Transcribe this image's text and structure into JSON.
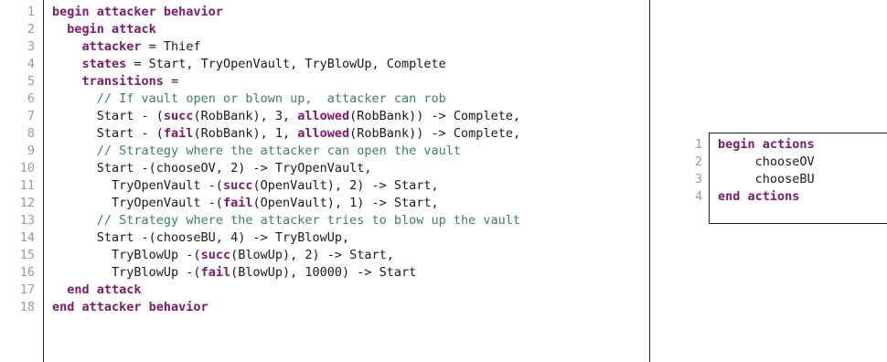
{
  "listings": [
    {
      "line_numbers": [
        "1",
        "2",
        "3",
        "4",
        "5",
        "6",
        "7",
        "8",
        "9",
        "10",
        "11",
        "12",
        "13",
        "14",
        "15",
        "16",
        "17",
        "18"
      ],
      "lines": [
        [
          {
            "t": "begin attacker behavior",
            "c": "kw"
          }
        ],
        [
          {
            "t": "  "
          },
          {
            "t": "begin attack",
            "c": "kw"
          }
        ],
        [
          {
            "t": "    "
          },
          {
            "t": "attacker",
            "c": "kw"
          },
          {
            "t": " = Thief"
          }
        ],
        [
          {
            "t": "    "
          },
          {
            "t": "states",
            "c": "kw"
          },
          {
            "t": " = Start, TryOpenVault, TryBlowUp, Complete"
          }
        ],
        [
          {
            "t": "    "
          },
          {
            "t": "transitions",
            "c": "kw"
          },
          {
            "t": " ="
          }
        ],
        [
          {
            "t": "      "
          },
          {
            "t": "// If vault open or blown up,  attacker can rob",
            "c": "cm"
          }
        ],
        [
          {
            "t": "      Start - ("
          },
          {
            "t": "succ",
            "c": "kw"
          },
          {
            "t": "(RobBank), 3, "
          },
          {
            "t": "allowed",
            "c": "kw"
          },
          {
            "t": "(RobBank)) -> Complete,"
          }
        ],
        [
          {
            "t": "      Start - ("
          },
          {
            "t": "fail",
            "c": "kw"
          },
          {
            "t": "(RobBank), 1, "
          },
          {
            "t": "allowed",
            "c": "kw"
          },
          {
            "t": "(RobBank)) -> Complete,"
          }
        ],
        [
          {
            "t": "      "
          },
          {
            "t": "// Strategy where the attacker can open the vault",
            "c": "cm"
          }
        ],
        [
          {
            "t": "      Start -(chooseOV, 2) -> TryOpenVault,"
          }
        ],
        [
          {
            "t": "        TryOpenVault -("
          },
          {
            "t": "succ",
            "c": "kw"
          },
          {
            "t": "(OpenVault), 2) -> Start,"
          }
        ],
        [
          {
            "t": "        TryOpenVault -("
          },
          {
            "t": "fail",
            "c": "kw"
          },
          {
            "t": "(OpenVault), 1) -> Start,"
          }
        ],
        [
          {
            "t": "      "
          },
          {
            "t": "// Strategy where the attacker tries to blow up the vault",
            "c": "cm"
          }
        ],
        [
          {
            "t": "      Start -(chooseBU, 4) -> TryBlowUp,"
          }
        ],
        [
          {
            "t": "        TryBlowUp -("
          },
          {
            "t": "succ",
            "c": "kw"
          },
          {
            "t": "(BlowUp), 2) -> Start,"
          }
        ],
        [
          {
            "t": "        TryBlowUp -("
          },
          {
            "t": "fail",
            "c": "kw"
          },
          {
            "t": "(BlowUp), 10000) -> Start"
          }
        ],
        [
          {
            "t": "  "
          },
          {
            "t": "end attack",
            "c": "kw"
          }
        ],
        [
          {
            "t": "end attacker behavior",
            "c": "kw"
          }
        ]
      ]
    },
    {
      "line_numbers": [
        "1",
        "2",
        "3",
        "4"
      ],
      "lines": [
        [
          {
            "t": "begin actions",
            "c": "kw"
          }
        ],
        [
          {
            "t": "     chooseOV"
          }
        ],
        [
          {
            "t": "     chooseBU"
          }
        ],
        [
          {
            "t": "end actions",
            "c": "kw"
          }
        ]
      ]
    }
  ]
}
